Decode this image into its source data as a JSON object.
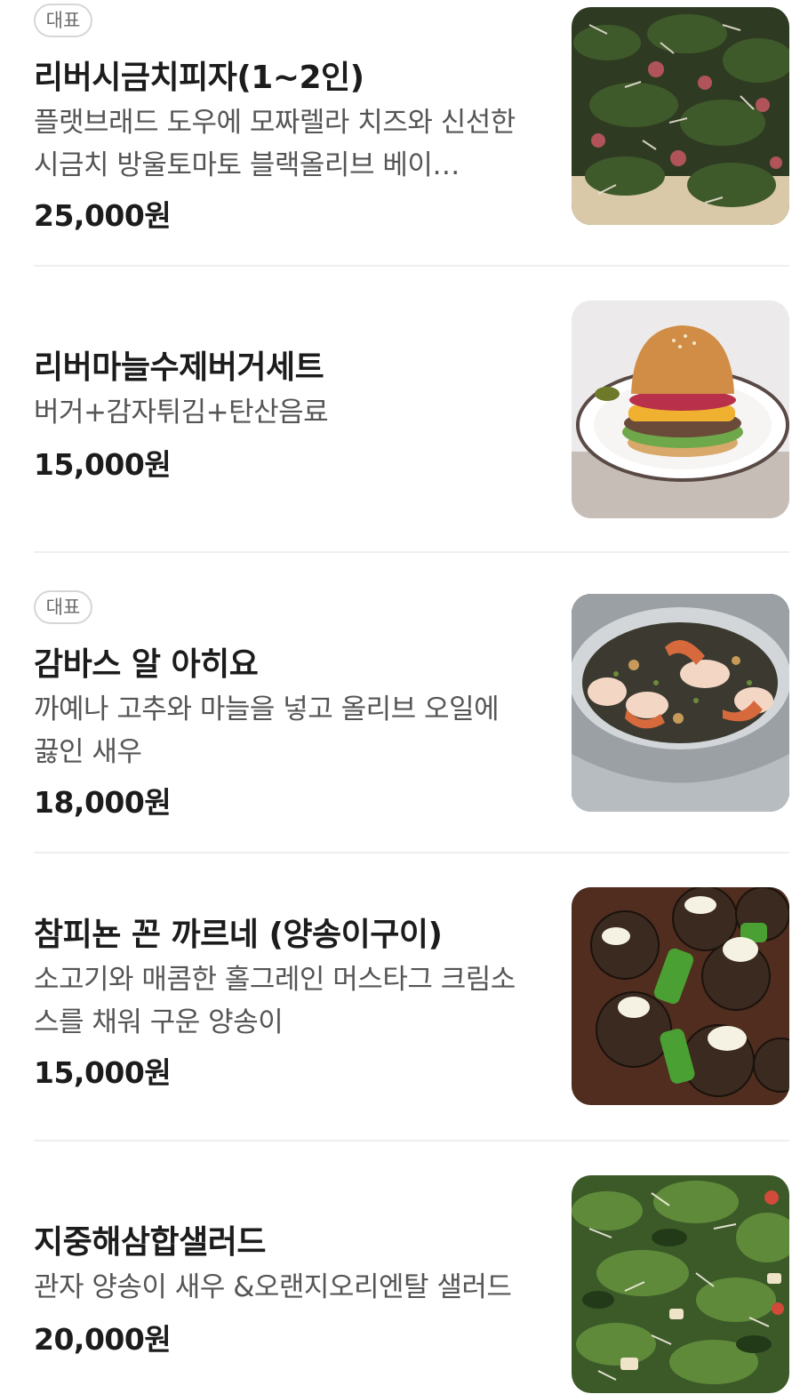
{
  "menu": {
    "items": [
      {
        "badge": "대표",
        "name": "리버시금치피자(1~2인)",
        "description": "플랫브래드 도우에 모짜렐라 치즈와 신선한 시금치 방울토마토 블랙올리브 베이…",
        "price": "25,000원",
        "photo": "spinach-pizza"
      },
      {
        "badge": "",
        "name": "리버마늘수제버거세트",
        "description": "버거+감자튀김+탄산음료",
        "price": "15,000원",
        "photo": "burger"
      },
      {
        "badge": "대표",
        "name": "감바스 알 아히요",
        "description": "까예나 고추와 마늘을 넣고 올리브 오일에 끓인 새우",
        "price": "18,000원",
        "photo": "gambas"
      },
      {
        "badge": "",
        "name": "참피뇬 꼰 까르네 (양송이구이)",
        "description": "소고기와 매콤한 홀그레인 머스타그 크림소스를 채워 구운 양송이",
        "price": "15,000원",
        "photo": "stuffed-mushrooms"
      },
      {
        "badge": "",
        "name": "지중해삼합샐러드",
        "description": "관자 양송이 새우 &오랜지오리엔탈 샐러드",
        "price": "20,000원",
        "photo": "salad"
      }
    ]
  },
  "colors": {
    "text_primary": "#1c1c1c",
    "text_secondary": "#555555",
    "badge_border": "#d6d6d6",
    "divider": "#efefef"
  }
}
